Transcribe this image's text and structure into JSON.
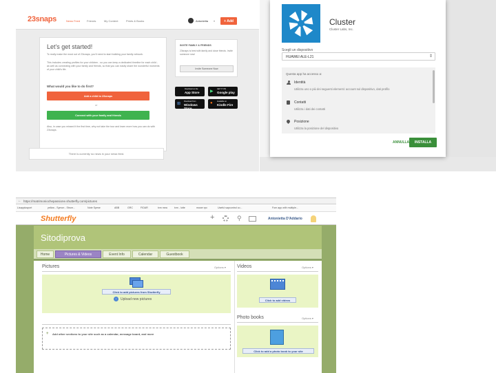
{
  "snaps": {
    "logo": "23snaps",
    "nav": [
      "News Feed",
      "Friends",
      "My Content",
      "Prints & Books"
    ],
    "user": "Antonietta",
    "add_label": "+ Add",
    "title": "Let's get started!",
    "intro": "To really make the most out of 23snaps, you'll need to start building your family network.",
    "body": "This includes creating profiles for your children - so you can keep a dedicated timeline for each child - as well as connecting with your family and friends, so that you can easily share the wonderful moments of your child's life.",
    "question": "What would you like to do first?",
    "add_child": "Add a child to 23snaps",
    "or": "or",
    "connect": "Connect with your family and friends",
    "footer": "Also, in case you missed it the first time, why not take the tour and learn more how you can do with 23snaps.",
    "invite_title": "INVITE FAMILY & FRIENDS",
    "invite_text": "23snaps is best with family and close friends. Invite someone now!",
    "invite_btn": "Invite Someone Now",
    "empty": "There is currently no news in your news feed.",
    "stores": [
      {
        "small": "Download on the",
        "big": "App Store"
      },
      {
        "small": "GET IT ON",
        "big": "Google play"
      },
      {
        "small": "Download from",
        "big": "Windows Store"
      },
      {
        "small": "Available on",
        "big": "Kindle Fire"
      }
    ]
  },
  "cluster": {
    "app": "Cluster",
    "publisher": "Cluster Labs, Inc.",
    "device_label": "Scegli un dispositivo",
    "device": "HUAWEI ALE-L21",
    "access_header": "Questa app ha accesso a:",
    "perms": [
      {
        "name": "Identità",
        "desc": "Utilizza uno o più dei seguenti elementi: account sul dispositivo, dati profilo"
      },
      {
        "name": "Contatti",
        "desc": "Utilizza i dati dei contatti"
      },
      {
        "name": "Posizione",
        "desc": "Utilizza la posizione del dispositivo"
      }
    ],
    "cancel": "ANNULLA",
    "install": "INSTALLA"
  },
  "shutterfly": {
    "url": "https://matrimoniochepassione.shutterfly.com/pictures",
    "bookmarks": [
      "Lisapplusport",
      "yellow - Symon - Strum...",
      "Note Spese",
      "ABB",
      "GRC",
      "FIDAR",
      "tvm mea",
      "tvm - lutte",
      "muser rpc",
      "Useful sapcontrol co...",
      "Fom app with multiple..."
    ],
    "logo": "Shutterfly",
    "user": "Antonietta D'Addario",
    "site_title": "Sitodiprova",
    "tabs": [
      "Home",
      "Pictures & Videos",
      "Event Info",
      "Calendar",
      "Guestbook"
    ],
    "pictures": "Pictures",
    "options": "Options ▾",
    "add_pictures": "Click to add pictures from Shutterfly",
    "upload": "Upload new pictures",
    "add_sections": "Add other sections to your site such as a calendar, message board, and more",
    "videos": "Videos",
    "add_videos": "Click to add videos",
    "photo_books": "Photo books",
    "add_book": "Click to add a photo book to your site"
  }
}
